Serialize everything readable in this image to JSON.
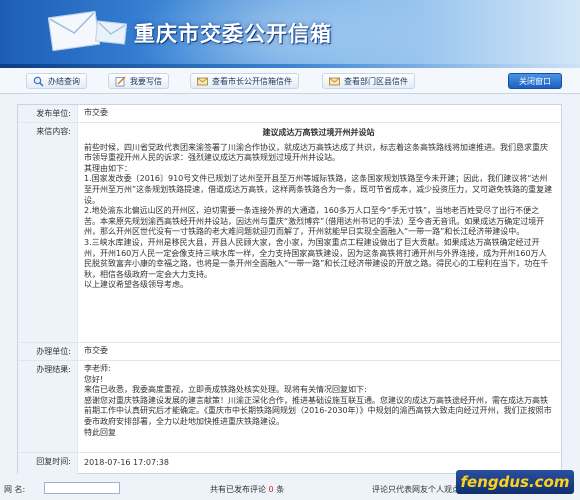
{
  "header": {
    "title": "重庆市交委公开信箱"
  },
  "nav": {
    "items": [
      {
        "label": "办结查询",
        "icon": "search-icon"
      },
      {
        "label": "我要写信",
        "icon": "write-icon"
      },
      {
        "label": "查看市长公开信箱信件",
        "icon": "mail-icon"
      },
      {
        "label": "查看部门区县信件",
        "icon": "mail-icon"
      }
    ],
    "close_label": "关闭窗口"
  },
  "letter": {
    "dept_label": "发布单位:",
    "dept_value": "市交委",
    "content_label": "来信内容:",
    "content_title": "建议成达万高铁过境开州并设站",
    "paragraphs": [
      "前些时候，四川省党政代表团来渝签署了川渝合作协议，就成达万高铁达成了共识，标志着这条高铁路线将加速推进。我们恳求重庆市领导重视开州人民的诉求：强烈建议成达万高铁规划过境开州并设站。",
      "其理由如下：",
      "1.国家发改委〔2016〕910号文件已规划了达州至开县至万州等城际铁路，这条国家规划铁路至今未开建；因此，我们建议将“达州至开州至万州”这条规划铁路提速，借道成达万高铁，这样两条铁路合为一条，既可节省成本，减少投资压力，又可避免铁路的重复建设。",
      "2.地处渝东北偏远山区的开州区，迫切需要一条连接外界的大通道，160多万人口至今“手无寸铁”，当地老百姓受尽了出行不便之苦。本来原先规划渝西高铁经开州并设站，因达州与重庆“激烈博弈”（借用达州书记的手法）至今杳无音讯。如果成达万确定过境开州，那么开州区世代没有一寸铁路的老大难问题就迎刃而解了，开州就能早日实现全面融入“一带一路”和长江经济带建设中。",
      "3.三峡水库建设，开州是移民大县，开县人民顾大家，舍小家，为国家重点工程建设做出了巨大贡献。如果成达万高铁确定经过开州，开州160万人民一定会像支持三峡水库一样，全力支持国家高铁建设，因为这条高铁将打通开州与外界连接，成为开州160万人民脱贫致富奔小康的幸福之路，也将是一条开州全面融入“一带一路”和长江经济带建设的开放之路。得民心的工程利在当下，功在千秋，相信各级政府一定会大力支持。",
      "以上建议希望各级领导考虑。"
    ],
    "handler_label": "办理单位:",
    "handler_value": "市交委",
    "result_label": "办理结果:",
    "result_paragraphs": [
      "李老师:",
      "您好!",
      "来信已收悉，我委高度重视，立即责成铁路处核实处理。现将有关情况回复如下:",
      "感谢您对重庆铁路建设发展的建言献策！川渝正深化合作，推进基础设施互联互通。您建议的成达万高铁途经开州，需在成达万高铁前期工作中认真研究后才能确定。《重庆市中长期铁路网规划（2016-2030年）》中规划的渝西高铁大致走向经过开州，我们正按照市委市政府安排部署，全力以赴地加快推进重庆铁路建设。",
      "特此回复"
    ],
    "reply_time_label": "回复时间:",
    "reply_time_value": "2018-07-16 17:07:38"
  },
  "footer": {
    "name_label": "网  名:",
    "comment_prefix": "共有已发布评论",
    "comment_count": "0",
    "comment_suffix": "条",
    "notice": "评论只代表网友个人观点",
    "watermark": "fengdus.com"
  },
  "colors": {
    "banner_start": "#1d5db8",
    "close_button": "#1c60c2",
    "label_bg": "#eef3fa",
    "count_red": "#d0281a",
    "watermark_text": "#ffd21a"
  }
}
